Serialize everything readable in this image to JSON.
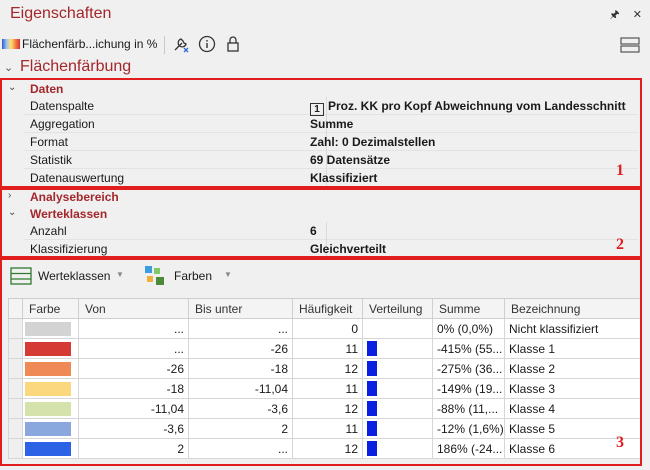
{
  "panel": {
    "title": "Eigenschaften",
    "pin_glyph": "🖈",
    "close_glyph": "✕"
  },
  "toolbar": {
    "layer_name": "Flächenfärb...ichung in %"
  },
  "section": {
    "title": "Flächenfärbung"
  },
  "daten": {
    "title": "Daten",
    "rows": [
      {
        "key": "Datenspalte",
        "badge": "1",
        "value": "Proz. KK pro Kopf Abweichnung vom Landesschnitt"
      },
      {
        "key": "Aggregation",
        "value": "Summe"
      },
      {
        "key": "Format",
        "value": "Zahl: 0 Dezimalstellen"
      },
      {
        "key": "Statistik",
        "value": "69 Datensätze"
      },
      {
        "key": "Datenauswertung",
        "value": "Klassifiziert"
      }
    ]
  },
  "analysebereich": {
    "title": "Analysebereich"
  },
  "werteklassen": {
    "title": "Werteklassen",
    "rows": [
      {
        "key": "Anzahl",
        "value": "6"
      },
      {
        "key": "Klassifizierung",
        "value": "Gleichverteilt"
      }
    ]
  },
  "subtoolbar": {
    "werteklassen_label": "Werteklassen",
    "farben_label": "Farben"
  },
  "markers": {
    "m1": "1",
    "m2": "2",
    "m3": "3"
  },
  "table": {
    "columns": [
      "Farbe",
      "Von",
      "Bis unter",
      "Häufigkeit",
      "Verteilung",
      "Summe",
      "Bezeichnung"
    ],
    "rows": [
      {
        "color": "#d3d3d3",
        "von": "...",
        "bis": "...",
        "count": "0",
        "bar": false,
        "summe": "0% (0,0%)",
        "name": "Nicht klassifiziert"
      },
      {
        "color": "#d63a35",
        "von": "...",
        "bis": "-26",
        "count": "11",
        "bar": true,
        "summe": "-415% (55...",
        "name": "Klasse 1"
      },
      {
        "color": "#ef8a57",
        "von": "-26",
        "bis": "-18",
        "count": "12",
        "bar": true,
        "summe": "-275% (36...",
        "name": "Klasse 2"
      },
      {
        "color": "#fbd77d",
        "von": "-18",
        "bis": "-11,04",
        "count": "11",
        "bar": true,
        "summe": "-149% (19...",
        "name": "Klasse 3"
      },
      {
        "color": "#d6e2ac",
        "von": "-11,04",
        "bis": "-3,6",
        "count": "12",
        "bar": true,
        "summe": "-88% (11,...",
        "name": "Klasse 4"
      },
      {
        "color": "#8aa8de",
        "von": "-3,6",
        "bis": "2",
        "count": "11",
        "bar": true,
        "summe": "-12% (1,6%)",
        "name": "Klasse 5"
      },
      {
        "color": "#2c62e6",
        "von": "2",
        "bis": "...",
        "count": "12",
        "bar": true,
        "summe": "186% (-24...",
        "name": "Klasse 6"
      }
    ]
  }
}
